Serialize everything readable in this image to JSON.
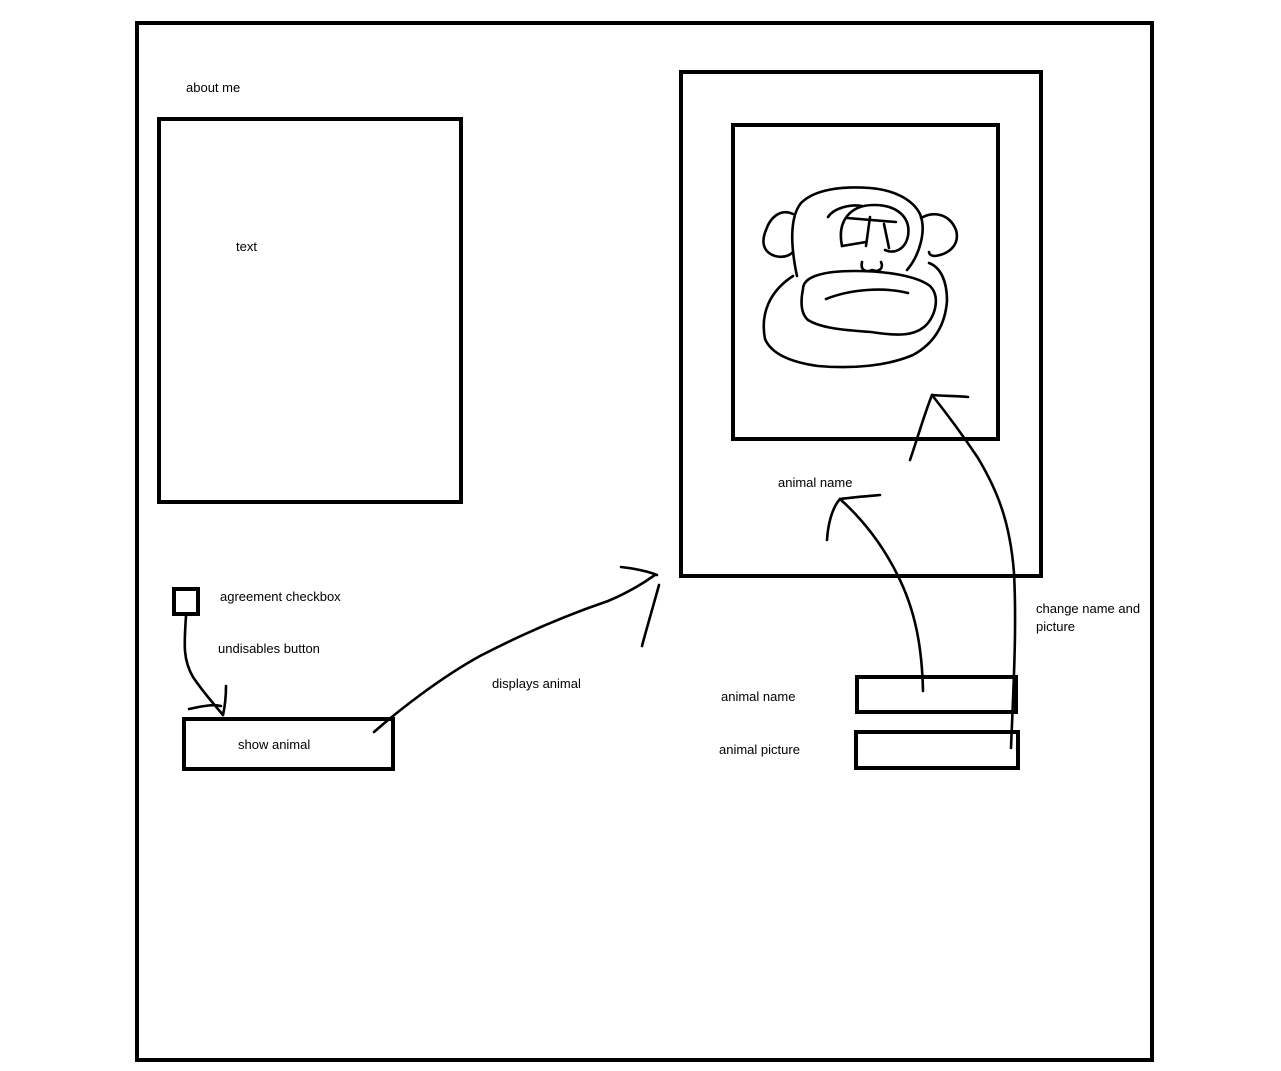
{
  "about": {
    "title": "about me",
    "text_placeholder": "text"
  },
  "card": {
    "animal_name_label": "animal name"
  },
  "controls": {
    "agreement_label": "agreement checkbox",
    "undisables_note": "undisables button",
    "show_button_label": "show animal",
    "displays_note": "displays animal"
  },
  "editor": {
    "change_note": "change name and picture",
    "name_field_label": "animal name",
    "picture_field_label": "animal picture"
  },
  "icons": {
    "animal_picture": "monkey-face-icon"
  }
}
